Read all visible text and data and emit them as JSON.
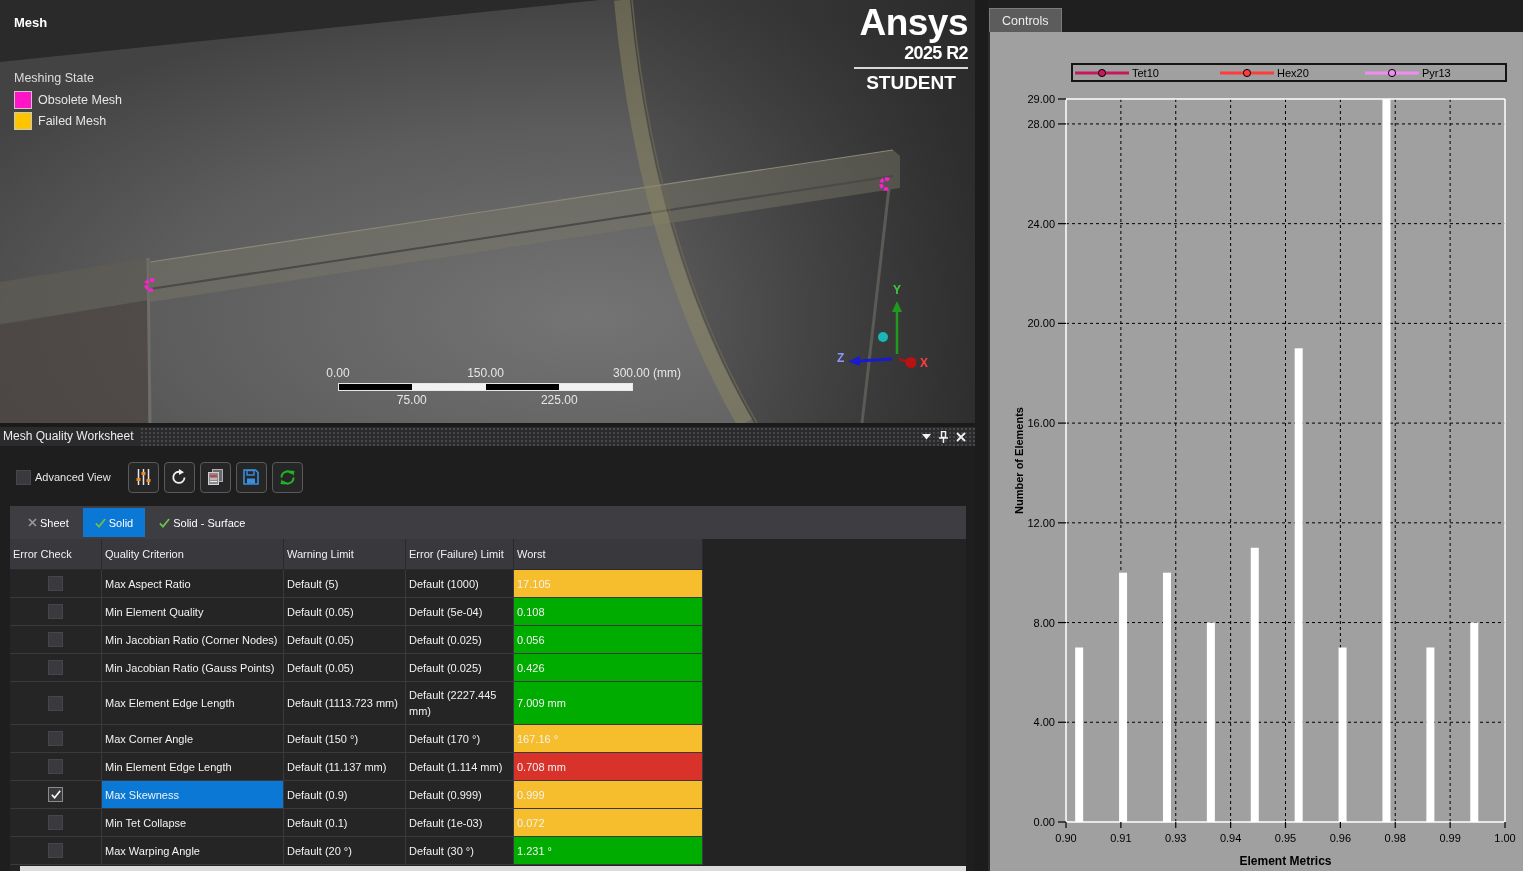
{
  "viewport": {
    "title": "Mesh",
    "legend_title": "Meshing State",
    "legend": [
      {
        "label": "Obsolete Mesh",
        "color": "#ff14c8"
      },
      {
        "label": "Failed Mesh",
        "color": "#ffc400"
      }
    ],
    "logo": {
      "name": "Ansys",
      "version": "2025 R2",
      "edition": "STUDENT"
    },
    "scale_bar": {
      "top_labels": [
        "0.00",
        "150.00",
        "300.00 (mm)"
      ],
      "bottom_labels": [
        "75.00",
        "225.00"
      ]
    },
    "triad": {
      "x": "X",
      "y": "Y",
      "z": "Z"
    }
  },
  "worksheet": {
    "title": "Mesh Quality Worksheet",
    "advanced_view": {
      "label": "Advanced View",
      "checked": false
    },
    "tabs": [
      {
        "label": "Sheet",
        "checked": false,
        "selected": false
      },
      {
        "label": "Solid",
        "checked": true,
        "selected": true
      },
      {
        "label": "Solid - Surface",
        "checked": true,
        "selected": false
      }
    ],
    "table": {
      "columns": [
        "Error Check",
        "Quality Criterion",
        "Warning Limit",
        "Error (Failure) Limit",
        "Worst"
      ],
      "rows": [
        {
          "checked": false,
          "selected": false,
          "criterion": "Max Aspect Ratio",
          "warning": "Default (5)",
          "error": "Default (1000)",
          "worst": "17.105",
          "color": "#f6bd2c"
        },
        {
          "checked": false,
          "selected": false,
          "criterion": "Min Element Quality",
          "warning": "Default (0.05)",
          "error": "Default (5e-04)",
          "worst": "0.108",
          "color": "#00ac00"
        },
        {
          "checked": false,
          "selected": false,
          "criterion": "Min Jacobian Ratio (Corner Nodes)",
          "warning": "Default (0.05)",
          "error": "Default (0.025)",
          "worst": "0.056",
          "color": "#00ac00"
        },
        {
          "checked": false,
          "selected": false,
          "criterion": "Min Jacobian Ratio (Gauss Points)",
          "warning": "Default (0.05)",
          "error": "Default (0.025)",
          "worst": "0.426",
          "color": "#00ac00"
        },
        {
          "checked": false,
          "selected": false,
          "criterion": "Max Element Edge Length",
          "warning": "Default (1113.723 mm)",
          "error": "Default (2227.445 mm)",
          "worst": "7.009 mm",
          "color": "#00ac00"
        },
        {
          "checked": false,
          "selected": false,
          "criterion": "Max Corner Angle",
          "warning": "Default (150 °)",
          "error": "Default (170 °)",
          "worst": "167.16 °",
          "color": "#f6bd2c"
        },
        {
          "checked": false,
          "selected": false,
          "criterion": "Min Element Edge Length",
          "warning": "Default (11.137 mm)",
          "error": "Default (1.114 mm)",
          "worst": "0.708 mm",
          "color": "#d9322a"
        },
        {
          "checked": true,
          "selected": true,
          "criterion": "Max Skewness",
          "warning": "Default (0.9)",
          "error": "Default (0.999)",
          "worst": "0.999",
          "color": "#f6bd2c"
        },
        {
          "checked": false,
          "selected": false,
          "criterion": "Min Tet Collapse",
          "warning": "Default (0.1)",
          "error": "Default (1e-03)",
          "worst": "0.072",
          "color": "#f6bd2c"
        },
        {
          "checked": false,
          "selected": false,
          "criterion": "Max Warping Angle",
          "warning": "Default (20 °)",
          "error": "Default (30 °)",
          "worst": "1.231 °",
          "color": "#00ac00"
        }
      ]
    }
  },
  "chart_panel": {
    "tab": "Controls",
    "legend": [
      {
        "label": "Tet10",
        "color": "#c8185c"
      },
      {
        "label": "Hex20",
        "color": "#ff3c3c"
      },
      {
        "label": "Pyr13",
        "color": "#f08cf0"
      }
    ],
    "chart_data": {
      "type": "bar",
      "xlabel": "Element Metrics",
      "ylabel": "Number of Elements",
      "x": [
        0.903,
        0.913,
        0.923,
        0.933,
        0.943,
        0.953,
        0.963,
        0.973,
        0.983,
        0.993
      ],
      "values": [
        7,
        10,
        10,
        8,
        11,
        19,
        7,
        29,
        7,
        8
      ],
      "xlim": [
        0.9,
        1.0
      ],
      "ylim": [
        0,
        29
      ],
      "grid": true,
      "xticks": [
        {
          "value": 0.9,
          "label": "0.90"
        },
        {
          "value": 0.9125,
          "label": "0.91"
        },
        {
          "value": 0.925,
          "label": "0.93"
        },
        {
          "value": 0.9375,
          "label": "0.94"
        },
        {
          "value": 0.95,
          "label": "0.95"
        },
        {
          "value": 0.9625,
          "label": "0.96"
        },
        {
          "value": 0.975,
          "label": "0.98"
        },
        {
          "value": 0.9875,
          "label": "0.99"
        },
        {
          "value": 1.0,
          "label": "1.00"
        }
      ],
      "yticks": [
        {
          "value": 0,
          "label": "0.00"
        },
        {
          "value": 4,
          "label": "4.00"
        },
        {
          "value": 8,
          "label": "8.00"
        },
        {
          "value": 12,
          "label": "12.00"
        },
        {
          "value": 16,
          "label": "16.00"
        },
        {
          "value": 20,
          "label": "20.00"
        },
        {
          "value": 24,
          "label": "24.00"
        },
        {
          "value": 28,
          "label": "28.00"
        },
        {
          "value": 29,
          "label": "29.00"
        }
      ]
    }
  }
}
